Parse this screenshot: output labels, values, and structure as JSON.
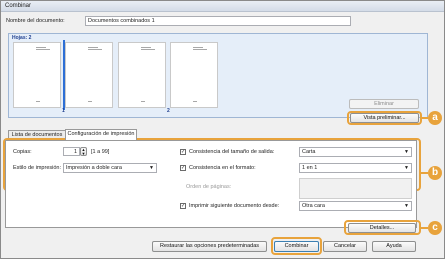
{
  "window": {
    "title": "Combinar"
  },
  "doc_name": {
    "label": "Nombre del documento:",
    "value": "Documentos combinados 1"
  },
  "pages": {
    "label": "Hojas: 2",
    "page_numbers": [
      "1",
      "2"
    ]
  },
  "buttons": {
    "delete": "Eliminar",
    "preview": "Vista preliminar...",
    "details": "Detalles...",
    "restore": "Restaurar las opciones predeterminadas",
    "combine": "Combinar",
    "cancel": "Cancelar",
    "help": "Ayuda"
  },
  "tabs": [
    {
      "label": "Lista de documentos"
    },
    {
      "label": "Configuración de impresión"
    }
  ],
  "settings": {
    "copies_label": "Copias:",
    "copies_value": "1",
    "copies_range": "[1 a 99]",
    "style_label": "Estilo de impresión:",
    "style_value": "Impresión a doble cara",
    "size_check_label": "Consistencia del tamaño de salida:",
    "size_value": "Carta",
    "format_check_label": "Consistencia en el formato:",
    "format_value": "1 en 1",
    "page_order_label": "Orden de páginas:",
    "next_doc_label": "Imprimir siguiente documento desde:",
    "next_doc_value": "Otra cara"
  },
  "callouts": [
    "a",
    "b",
    "c"
  ],
  "accent_color": "#e8a33c"
}
